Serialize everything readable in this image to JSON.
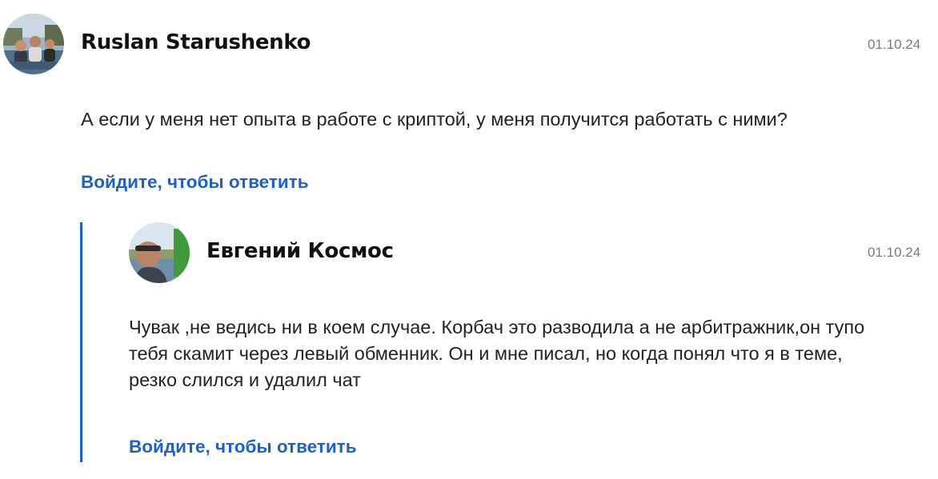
{
  "colors": {
    "link": "#1f5fc8",
    "thread_line": "#1f5fc8",
    "date": "#7a7a7a"
  },
  "comment": {
    "author": "Ruslan Starushenko",
    "date": "01.10.24",
    "text": "А если у меня нет опыта в работе с криптой, у меня получится работать с ними?",
    "reply_label": "Войдите, чтобы ответить"
  },
  "reply": {
    "author": "Евгений Космос",
    "date": "01.10.24",
    "text": "Чувак ,не ведись ни в коем случае. Корбач это разводила а не арбитражник,он тупо тебя скамит через левый обменник. Он и мне писал, но когда понял что я в теме, резко слился и удалил чат",
    "reply_label": "Войдите, чтобы ответить"
  }
}
